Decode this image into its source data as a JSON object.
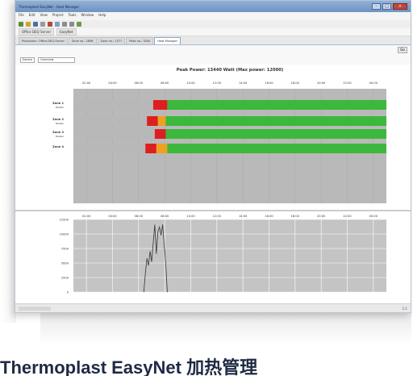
{
  "window": {
    "title": "Thermoplast EasyNet - Heat Manager",
    "menu": [
      "File",
      "Edit",
      "View",
      "Project",
      "Tools",
      "Window",
      "Help"
    ],
    "address_tabs": [
      "Office DEQ Server",
      "EasyNet"
    ],
    "tabs": [
      "Production: Office-DEQ-Server",
      "Zone no.: 2896",
      "Zone no.: 1377",
      "Peak no.: 3000",
      "Heat Manager"
    ],
    "subbar_button": "Go",
    "filter_select": "Device",
    "filter_mode": "Overview",
    "status_right": "1:1"
  },
  "chart_data": [
    {
      "type": "heatmap",
      "title": "Peak Power: 13440 Watt (Max power: 12000)",
      "x_ticks": [
        "02:00",
        "04:00",
        "06:00",
        "08:00",
        "10:00",
        "12:00",
        "14:00",
        "16:00",
        "18:00",
        "20:00",
        "22:00",
        "00:00"
      ],
      "rows": [
        {
          "label": "Zone 1",
          "sub": "Heater",
          "segments": [
            {
              "state": "off",
              "from": 0,
              "to": 0.255
            },
            {
              "state": "alarm",
              "from": 0.255,
              "to": 0.3
            },
            {
              "state": "ok",
              "from": 0.3,
              "to": 1.0
            }
          ]
        },
        {
          "label": "Zone 2",
          "sub": "Heater",
          "segments": [
            {
              "state": "off",
              "from": 0,
              "to": 0.235
            },
            {
              "state": "alarm",
              "from": 0.235,
              "to": 0.27
            },
            {
              "state": "warning",
              "from": 0.27,
              "to": 0.295
            },
            {
              "state": "ok",
              "from": 0.295,
              "to": 1.0
            }
          ]
        },
        {
          "label": "Zone 3",
          "sub": "Heater",
          "segments": [
            {
              "state": "off",
              "from": 0,
              "to": 0.26
            },
            {
              "state": "alarm",
              "from": 0.26,
              "to": 0.295
            },
            {
              "state": "ok",
              "from": 0.295,
              "to": 1.0
            }
          ]
        },
        {
          "label": "Zone 4",
          "sub": "",
          "segments": [
            {
              "state": "off",
              "from": 0,
              "to": 0.23
            },
            {
              "state": "alarm",
              "from": 0.23,
              "to": 0.265
            },
            {
              "state": "warning",
              "from": 0.265,
              "to": 0.3
            },
            {
              "state": "ok",
              "from": 0.3,
              "to": 1.0
            }
          ]
        }
      ],
      "colors": {
        "off": "#b8b8b8",
        "alarm": "#dd1f1f",
        "warning": "#f0a020",
        "ok": "#3cb83c"
      }
    },
    {
      "type": "line",
      "x_ticks": [
        "02:00",
        "04:00",
        "06:00",
        "08:00",
        "10:00",
        "12:00",
        "14:00",
        "16:00",
        "18:00",
        "20:00",
        "22:00",
        "00:00"
      ],
      "y_ticks": [
        "0",
        "2500",
        "5000",
        "7500",
        "10000",
        "12500"
      ],
      "ylim": [
        0,
        12500
      ],
      "series": [
        {
          "x": [
            0.225,
            0.23,
            0.235,
            0.24,
            0.245,
            0.25,
            0.255,
            0.26,
            0.265,
            0.27,
            0.275,
            0.28,
            0.285,
            0.29,
            0.295,
            0.3
          ],
          "y": [
            0,
            3200,
            5800,
            4600,
            7000,
            5200,
            8400,
            11600,
            6600,
            10400,
            11200,
            9800,
            11600,
            8200,
            4800,
            0
          ]
        }
      ],
      "colors": {
        "line": "#333333",
        "plot_bg": "#c4c4c4",
        "grid": "#ffffff"
      }
    }
  ],
  "caption": "Thermoplast EasyNet 加热管理"
}
